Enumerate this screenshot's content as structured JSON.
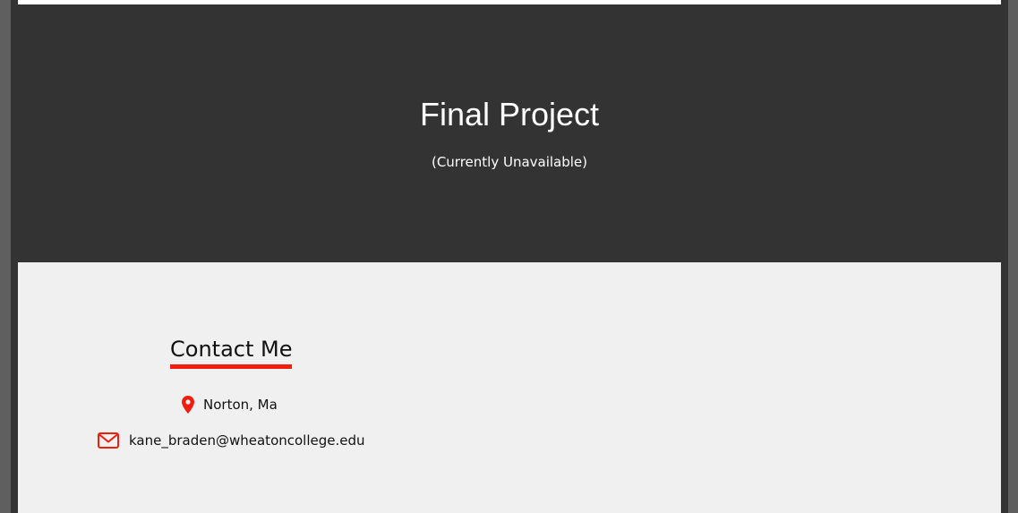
{
  "hero": {
    "title": "Final Project",
    "subtitle": "(Currently Unavailable)"
  },
  "contact": {
    "heading": "Contact Me",
    "location": "Norton, Ma",
    "email": "kane_braden@wheatoncollege.edu"
  },
  "colors": {
    "accent": "#f21d0c",
    "hero_background": "#333333",
    "section_background": "#f0f0f0",
    "outer_background": "#5f5f5f"
  },
  "icons": {
    "location": "map-pin-icon",
    "email": "envelope-icon"
  }
}
